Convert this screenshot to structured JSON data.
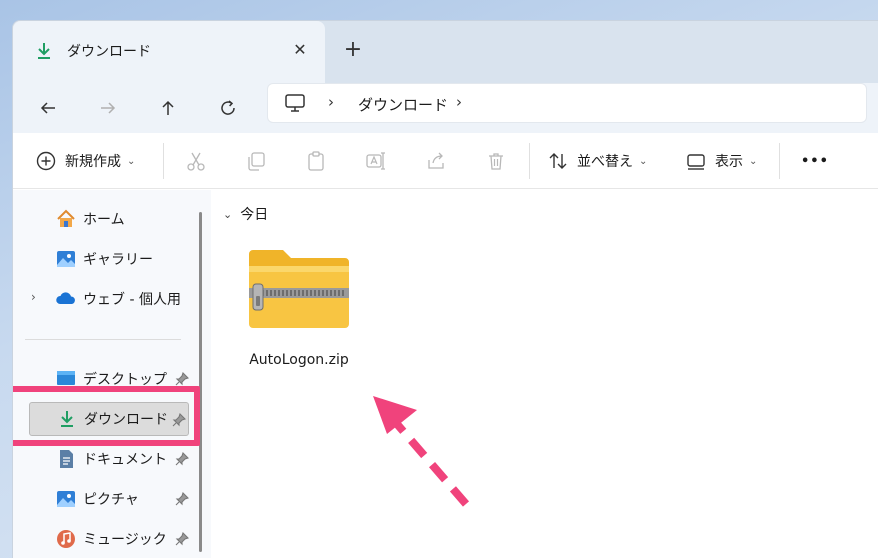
{
  "tab": {
    "title": "ダウンロード",
    "close": "✕",
    "new": "+"
  },
  "address": {
    "sep": "›",
    "location": "ダウンロード"
  },
  "command_bar": {
    "new": "新規作成",
    "sort": "並べ替え",
    "view": "表示",
    "more": "•••"
  },
  "sidebar": {
    "home": "ホーム",
    "gallery": "ギャラリー",
    "onedrive": "ウェブ - 個人用",
    "desktop": "デスクトップ",
    "downloads": "ダウンロード",
    "documents": "ドキュメント",
    "pictures": "ピクチャ",
    "music": "ミュージック"
  },
  "content": {
    "group": "今日",
    "file_name": "AutoLogon.zip"
  },
  "colors": {
    "accent": "#f0437c",
    "download_green": "#1f9e63",
    "folder_yellow": "#f8c542"
  }
}
